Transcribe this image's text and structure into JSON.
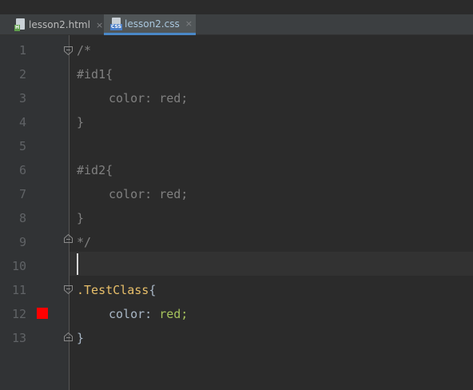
{
  "tabs": [
    {
      "label": "lesson2.html",
      "close": "×",
      "active": false,
      "icon": "html-file-icon",
      "stamp": "H"
    },
    {
      "label": "lesson2.css",
      "close": "×",
      "active": true,
      "icon": "css-file-icon",
      "stamp": "CSS"
    }
  ],
  "editor": {
    "current_line": 10,
    "lines": [
      {
        "num": "1",
        "text": "/*"
      },
      {
        "num": "2",
        "text": "#id1{"
      },
      {
        "num": "3",
        "text": "color: red;"
      },
      {
        "num": "4",
        "text": "}"
      },
      {
        "num": "5",
        "text": ""
      },
      {
        "num": "6",
        "text": "#id2{"
      },
      {
        "num": "7",
        "text": "color: red;"
      },
      {
        "num": "8",
        "text": "}"
      },
      {
        "num": "9",
        "text": "*/"
      },
      {
        "num": "10",
        "text": ""
      },
      {
        "num": "11",
        "selector": ".TestClass",
        "brace": "{"
      },
      {
        "num": "12",
        "prop": "color:",
        "value": "red;"
      },
      {
        "num": "13",
        "brace": "}"
      }
    ]
  },
  "colors": {
    "background": "#2b2b2b",
    "gutter": "#313335",
    "comment": "#808080",
    "selector": "#e8bf6a",
    "value": "#a5c25c",
    "swatch": "#ff0000",
    "active_tab_underline": "#4a88c7"
  }
}
